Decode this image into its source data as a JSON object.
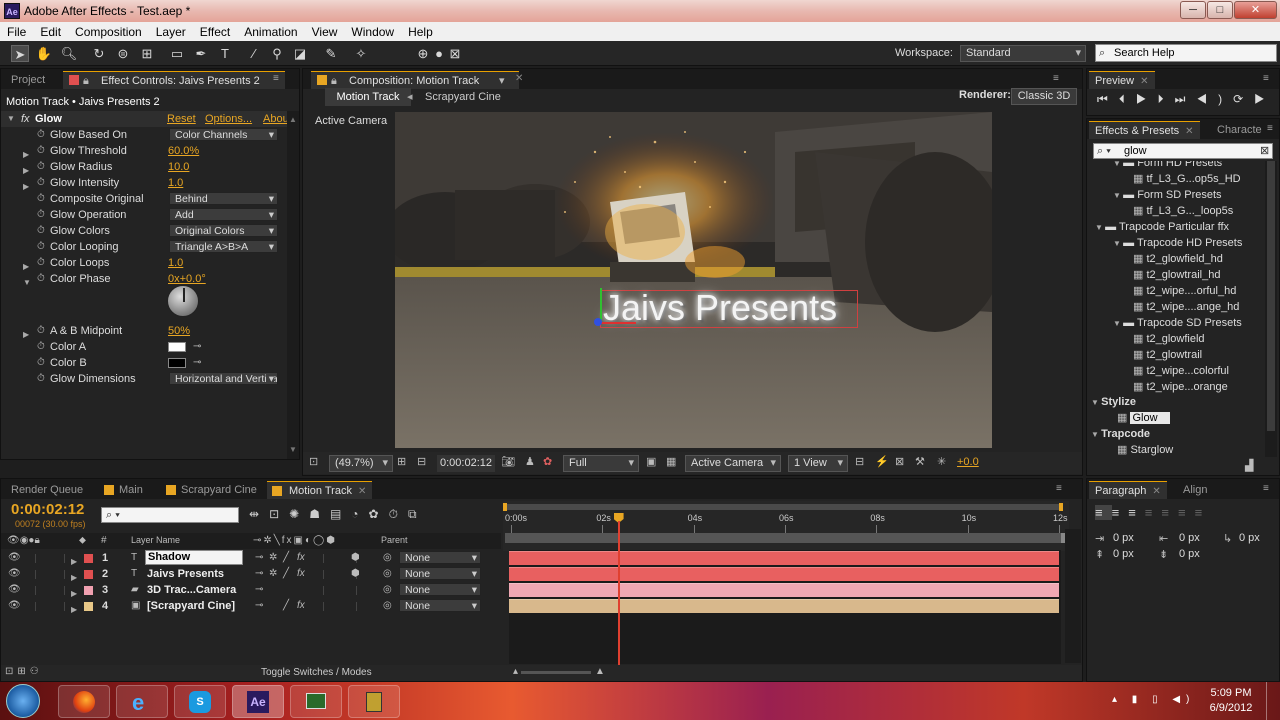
{
  "window": {
    "title": "Adobe After Effects - Test.aep *",
    "app_badge": "Ae",
    "minimize": "─",
    "maximize": "□",
    "close": "✕"
  },
  "menu": [
    "File",
    "Edit",
    "Composition",
    "Layer",
    "Effect",
    "Animation",
    "View",
    "Window",
    "Help"
  ],
  "toolbar": {
    "workspace_label": "Workspace:",
    "workspace_value": "Standard",
    "search_help": "Search Help"
  },
  "project_panel": {
    "tab_project": "Project",
    "tab_effect_controls": "Effect Controls: Jaivs Presents 2",
    "header": "Motion Track • Jaivs Presents 2",
    "effect_name": "Glow",
    "reset": "Reset",
    "options": "Options...",
    "about": "Abou",
    "properties": [
      {
        "label": "Glow Based On",
        "value": "Color Channels",
        "kind": "dropdown"
      },
      {
        "label": "Glow Threshold",
        "value": "60.0%",
        "kind": "value"
      },
      {
        "label": "Glow Radius",
        "value": "10.0",
        "kind": "value"
      },
      {
        "label": "Glow Intensity",
        "value": "1.0",
        "kind": "value"
      },
      {
        "label": "Composite Original",
        "value": "Behind",
        "kind": "dropdown"
      },
      {
        "label": "Glow Operation",
        "value": "Add",
        "kind": "dropdown"
      },
      {
        "label": "Glow Colors",
        "value": "Original Colors",
        "kind": "dropdown"
      },
      {
        "label": "Color Looping",
        "value": "Triangle A>B>A",
        "kind": "dropdown"
      },
      {
        "label": "Color Loops",
        "value": "1.0",
        "kind": "value"
      },
      {
        "label": "Color Phase",
        "value": "0x+0.0°",
        "kind": "value"
      }
    ],
    "properties2": [
      {
        "label": "A & B Midpoint",
        "value": "50%",
        "kind": "value"
      },
      {
        "label": "Color A",
        "value": "",
        "kind": "color",
        "color": "#ffffff"
      },
      {
        "label": "Color B",
        "value": "",
        "kind": "color",
        "color": "#000000"
      },
      {
        "label": "Glow Dimensions",
        "value": "Horizontal and Vertical",
        "kind": "dropdown"
      }
    ]
  },
  "composition": {
    "tab": "Composition: Motion Track",
    "crumb1": "Motion Track",
    "crumb2": "Scrapyard Cine",
    "renderer_label": "Renderer:",
    "renderer_value": "Classic 3D",
    "view_label": "Active Camera",
    "overlay_text": "Jaivs Presents",
    "zoom": "(49.7%)",
    "timecode": "0:00:02:12",
    "resolution": "Full",
    "camera": "Active Camera",
    "views": "1 View",
    "exposure": "+0.0"
  },
  "preview": {
    "tab": "Preview"
  },
  "effects_presets": {
    "tab": "Effects & Presets",
    "tab2": "Characte",
    "search": "glow",
    "items": [
      {
        "label": "Form HD Presets",
        "level": 2,
        "folder": true
      },
      {
        "label": "tf_L3_G...op5s_HD",
        "level": 3,
        "folder": false
      },
      {
        "label": "Form SD Presets",
        "level": 2,
        "folder": true
      },
      {
        "label": "tf_L3_G..._loop5s",
        "level": 3,
        "folder": false
      },
      {
        "label": "Trapcode Particular ffx",
        "level": 1,
        "folder": true
      },
      {
        "label": "Trapcode HD Presets",
        "level": 2,
        "folder": true
      },
      {
        "label": "t2_glowfield_hd",
        "level": 3,
        "folder": false
      },
      {
        "label": "t2_glowtrail_hd",
        "level": 3,
        "folder": false
      },
      {
        "label": "t2_wipe....orful_hd",
        "level": 3,
        "folder": false
      },
      {
        "label": "t2_wipe....ange_hd",
        "level": 3,
        "folder": false
      },
      {
        "label": "Trapcode SD Presets",
        "level": 2,
        "folder": true
      },
      {
        "label": "t2_glowfield",
        "level": 3,
        "folder": false
      },
      {
        "label": "t2_glowtrail",
        "level": 3,
        "folder": false
      },
      {
        "label": "t2_wipe...colorful",
        "level": 3,
        "folder": false
      },
      {
        "label": "t2_wipe...orange",
        "level": 3,
        "folder": false
      }
    ],
    "cat1": "Stylize",
    "cat1_item": "Glow",
    "cat2": "Trapcode",
    "cat2_item": "Starglow"
  },
  "timeline": {
    "tabs": [
      "Render Queue",
      "Main",
      "Scrapyard Cine",
      "Motion Track"
    ],
    "timecode": "0:00:02:12",
    "frame_info": "00072 (30.00 fps)",
    "col_layer_name": "Layer Name",
    "col_parent": "Parent",
    "col_num": "#",
    "ruler": [
      "0:00s",
      "02s",
      "04s",
      "06s",
      "08s",
      "10s",
      "12s"
    ],
    "layers": [
      {
        "num": "1",
        "name": "Shadow",
        "type": "T",
        "color": "#e05050",
        "bar": "#e86060",
        "parent": "None"
      },
      {
        "num": "2",
        "name": "Jaivs Presents",
        "type": "T",
        "color": "#e05050",
        "bar": "#e86060",
        "parent": "None"
      },
      {
        "num": "3",
        "name": "3D Trac...Camera",
        "type": "cam",
        "color": "#f0a0b0",
        "bar": "#f0a8b4",
        "parent": "None"
      },
      {
        "num": "4",
        "name": "[Scrapyard Cine]",
        "type": "comp",
        "color": "#e8c888",
        "bar": "#d8b88c",
        "parent": "None"
      }
    ],
    "playhead_fraction": 0.2,
    "toggle_label": "Toggle Switches / Modes"
  },
  "paragraph": {
    "tab": "Paragraph",
    "tab2": "Align",
    "fields": [
      "0 px",
      "0 px",
      "0 px",
      "0 px",
      "0 px"
    ]
  },
  "taskbar": {
    "time": "5:09 PM",
    "date": "6/9/2012"
  }
}
